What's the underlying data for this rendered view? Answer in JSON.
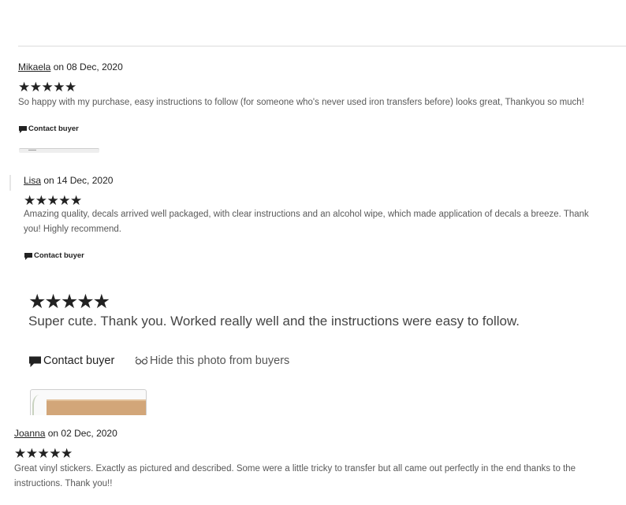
{
  "reviews": [
    {
      "author": "Mikaela",
      "date_text": " on 08 Dec, 2020",
      "stars": "★★★★★",
      "text": "So happy with my purchase, easy instructions to follow (for someone who's never used iron transfers before) looks great, Thankyou so much!",
      "contact_label": "Contact buyer"
    },
    {
      "author": "Lisa",
      "date_text": " on 14 Dec, 2020",
      "stars": "★★★★★",
      "text": "Amazing quality, decals arrived well packaged, with clear instructions and an alcohol wipe, which made application of decals a breeze. Thank you! Highly recommend.",
      "contact_label": "Contact buyer"
    },
    {
      "author": "Joanna",
      "date_text": " on 02 Dec, 2020",
      "stars": "★★★★★",
      "text": "Great vinyl stickers. Exactly as pictured and described. Some were a little tricky to transfer but all came out perfectly in the end thanks to the instructions. Thank you!!"
    }
  ],
  "featured_review": {
    "stars": "★★★★★",
    "text": "Super cute. Thank you. Worked really well and the instructions were easy to follow.",
    "contact_label": "Contact buyer",
    "hide_photo_label": "Hide this photo from buyers",
    "rating": 5
  },
  "icons": {
    "contact": "speech-bubble-icon",
    "hide": "eye-slash-icon"
  }
}
